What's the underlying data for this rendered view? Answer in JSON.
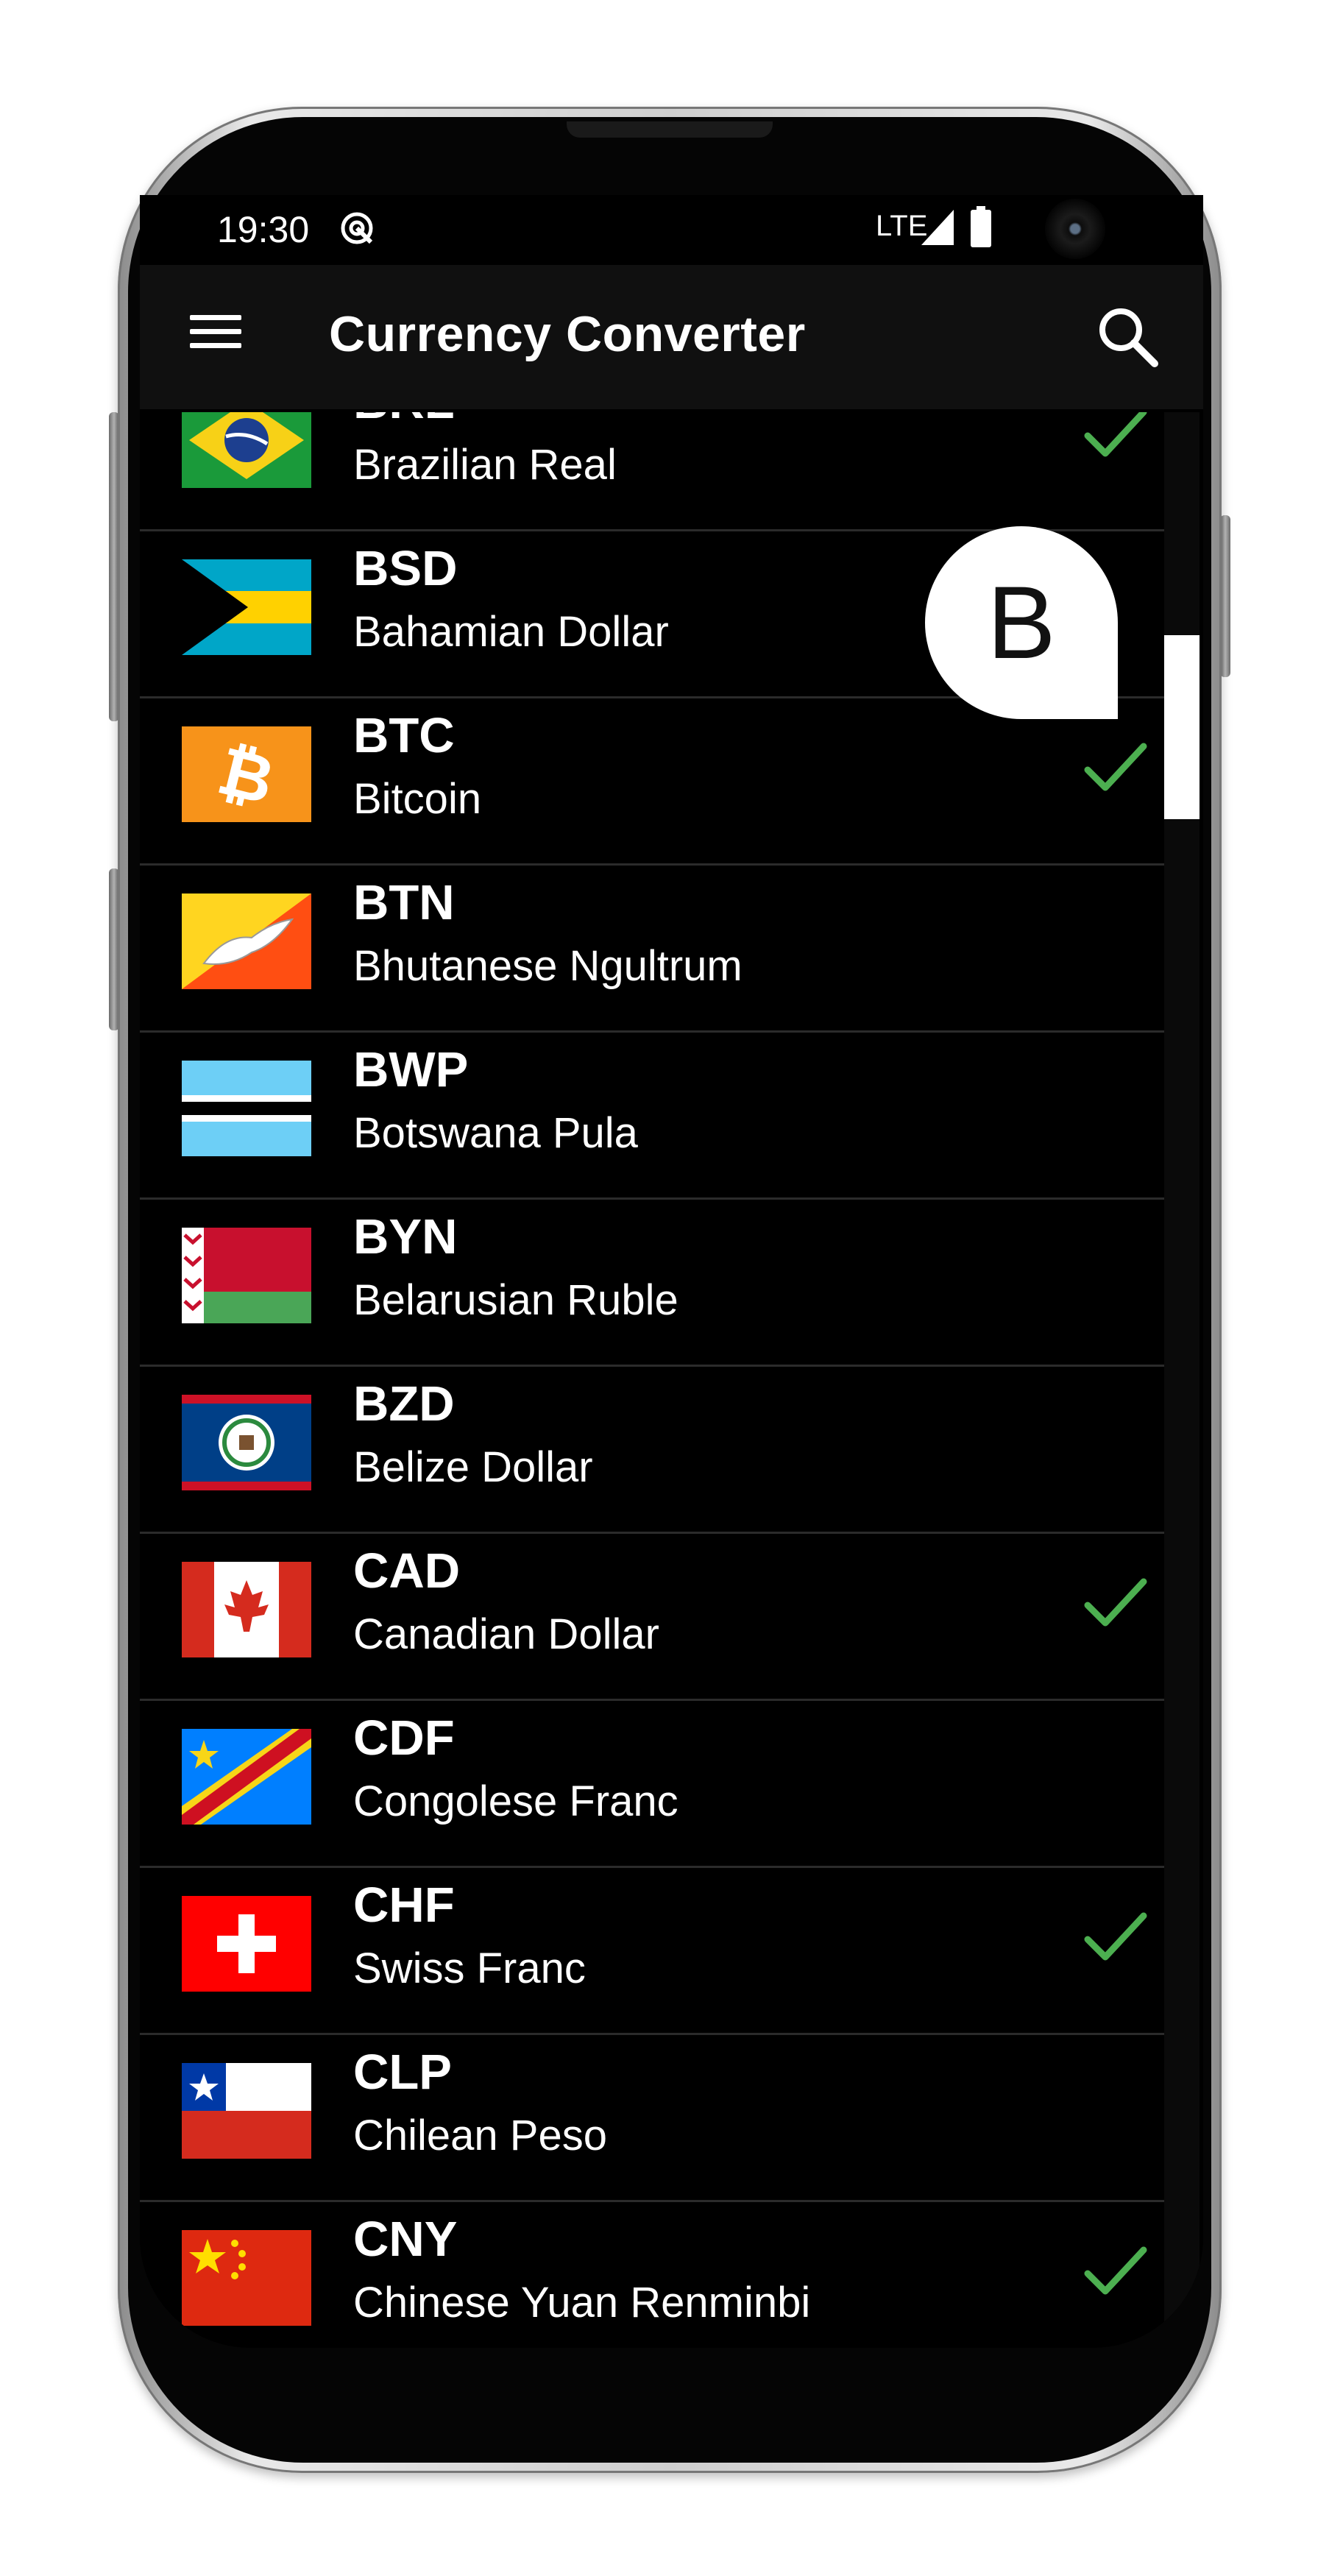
{
  "status_bar": {
    "time": "19:30",
    "network": "LTE"
  },
  "app_bar": {
    "title": "Currency Converter"
  },
  "fast_scroll": {
    "letter": "B"
  },
  "colors": {
    "check": "#4caf50",
    "app_bar_bg": "#101010",
    "list_bg": "#000000"
  },
  "currencies": [
    {
      "code": "BRL",
      "name": "Brazilian Real",
      "selected": true,
      "flag": "brazil-flag"
    },
    {
      "code": "BSD",
      "name": "Bahamian Dollar",
      "selected": false,
      "flag": "bahamas-flag"
    },
    {
      "code": "BTC",
      "name": "Bitcoin",
      "selected": true,
      "flag": "bitcoin-icon"
    },
    {
      "code": "BTN",
      "name": "Bhutanese Ngultrum",
      "selected": false,
      "flag": "bhutan-flag"
    },
    {
      "code": "BWP",
      "name": "Botswana Pula",
      "selected": false,
      "flag": "botswana-flag"
    },
    {
      "code": "BYN",
      "name": "Belarusian Ruble",
      "selected": false,
      "flag": "belarus-flag"
    },
    {
      "code": "BZD",
      "name": "Belize Dollar",
      "selected": false,
      "flag": "belize-flag"
    },
    {
      "code": "CAD",
      "name": "Canadian Dollar",
      "selected": true,
      "flag": "canada-flag"
    },
    {
      "code": "CDF",
      "name": "Congolese Franc",
      "selected": false,
      "flag": "congo-flag"
    },
    {
      "code": "CHF",
      "name": "Swiss Franc",
      "selected": true,
      "flag": "switzerland-flag"
    },
    {
      "code": "CLP",
      "name": "Chilean Peso",
      "selected": false,
      "flag": "chile-flag"
    },
    {
      "code": "CNY",
      "name": "Chinese Yuan Renminbi",
      "selected": true,
      "flag": "china-flag"
    }
  ]
}
